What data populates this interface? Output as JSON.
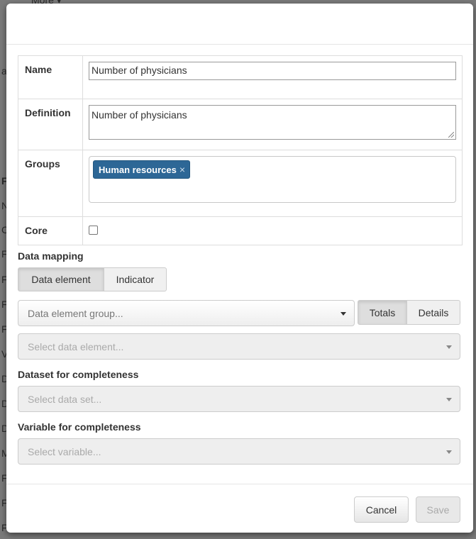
{
  "background": {
    "more_label": "More ▾",
    "side_letters": [
      "a",
      "Fu",
      "N",
      "C",
      "F",
      "F",
      "F",
      "F",
      "V",
      "D",
      "D",
      "D",
      "M",
      "F",
      "F",
      "F"
    ]
  },
  "form": {
    "name_label": "Name",
    "name_value": "Number of physicians",
    "definition_label": "Definition",
    "definition_value": "Number of physicians",
    "groups_label": "Groups",
    "groups_tags": [
      "Human resources"
    ],
    "tag_remove_glyph": "×",
    "core_label": "Core",
    "core_checked": false
  },
  "data_mapping": {
    "label": "Data mapping",
    "type_options": [
      "Data element",
      "Indicator"
    ],
    "selected_type": "Data element",
    "group_select_placeholder": "Data element group...",
    "aggregation_options": [
      "Totals",
      "Details"
    ],
    "selected_aggregation": "Totals",
    "element_select_placeholder": "Select data element..."
  },
  "completeness": {
    "dataset_label": "Dataset for completeness",
    "dataset_placeholder": "Select data set...",
    "variable_label": "Variable for completeness",
    "variable_placeholder": "Select variable..."
  },
  "footer": {
    "cancel_label": "Cancel",
    "save_label": "Save"
  },
  "colors": {
    "tag_background": "#2d6796",
    "backdrop": "#7a7a7a"
  }
}
